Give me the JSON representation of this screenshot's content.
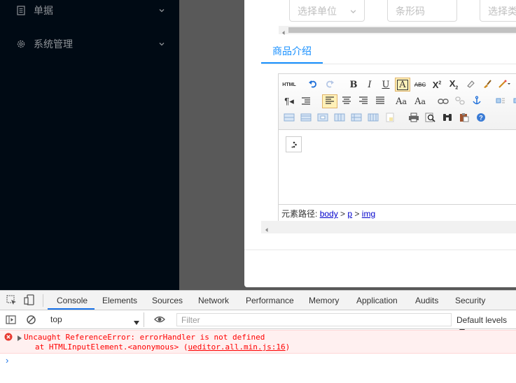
{
  "sidebar": {
    "items": [
      {
        "label": "单据",
        "icon": "document-icon"
      },
      {
        "label": "系统管理",
        "icon": "gear-icon"
      }
    ]
  },
  "form": {
    "unit_placeholder": "选择单位",
    "barcode_placeholder": "条形码",
    "type_placeholder": "选择类"
  },
  "tabs": [
    {
      "label": "商品介绍"
    }
  ],
  "editor": {
    "html_label": "HTML",
    "path_label": "元素路径:",
    "path_items": [
      "body",
      "p",
      "img"
    ]
  },
  "devtools": {
    "tabs": [
      "Console",
      "Elements",
      "Sources",
      "Network",
      "Performance",
      "Memory",
      "Application",
      "Audits",
      "Security"
    ],
    "active_tab": "Console",
    "context": "top",
    "filter_placeholder": "Filter",
    "levels": "Default levels",
    "error_line1": "Uncaught ReferenceError: errorHandler is not defined",
    "error_line2_prefix": "at HTMLInputElement.<anonymous> (",
    "error_link": "ueditor.all.min.js:16",
    "error_line2_suffix": ")"
  },
  "colors": {
    "accent": "#1890ff",
    "sidebar_bg": "#000a14",
    "error": "#ff0000"
  }
}
